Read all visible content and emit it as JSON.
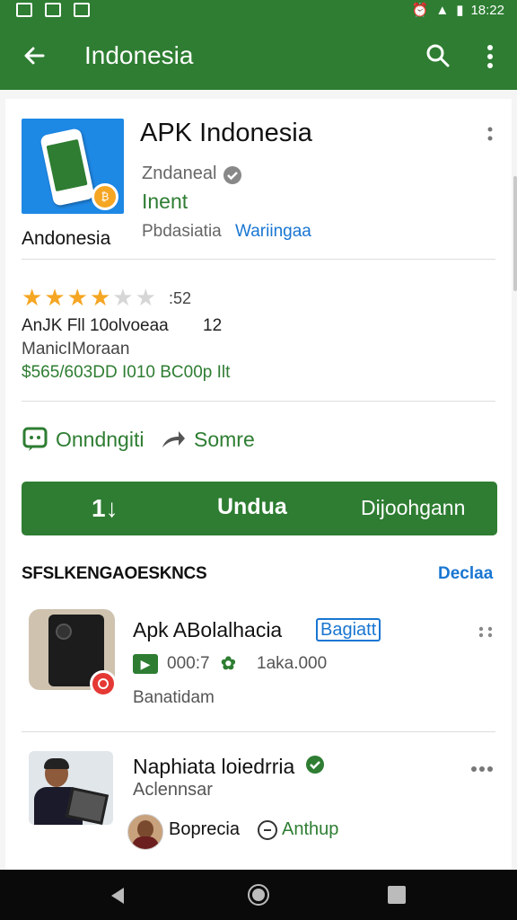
{
  "status_bar": {
    "time": "18:22"
  },
  "app_bar": {
    "title": "Indonesia"
  },
  "app": {
    "name": "APK Indonesia",
    "icon_label": "Andonesia",
    "developer": "Zndaneal",
    "category": "Inent",
    "meta_label": "Pbdasiatia",
    "meta_link": "Wariingaa",
    "rating_count": ":52",
    "rating_stars": 4,
    "info_line1": "AnJK Fll 10olvoeaa",
    "info_line1_value": "12",
    "info_line2": "ManicIMoraan",
    "price_line": "$565/603DD  I010 BC00p Ilt"
  },
  "actions": {
    "wishlist": "Onndngiti",
    "share": "Somre"
  },
  "install_button": {
    "label": "Undua",
    "secondary": "Dijoohgann",
    "icon_text": "1↓"
  },
  "section": {
    "title": "SFSLKENGAOESKNCS",
    "link": "Declaa"
  },
  "list": [
    {
      "title": "Apk ABolalhacia",
      "badge": "Bagiatt",
      "meta1": "000:7",
      "meta2": "1aka.000",
      "sub": "Banatidam"
    },
    {
      "title": "Naphiata loiedrria",
      "sub": "Aclennsar",
      "author": "Boprecia",
      "tag": "Anthup"
    }
  ],
  "colors": {
    "primary": "#2e7d32",
    "link": "#1976d2",
    "star": "#f5a623",
    "rec": "#e53935"
  }
}
